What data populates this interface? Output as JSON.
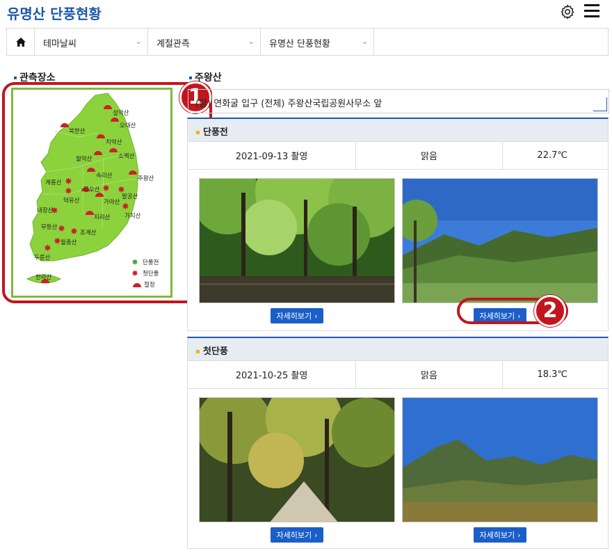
{
  "header": {
    "title": "유명산 단풍현황"
  },
  "nav": {
    "items": [
      "테마날씨",
      "계절관측",
      "유명산 단풍현황"
    ]
  },
  "left": {
    "section_title": "관측장소"
  },
  "map": {
    "mountains": [
      "설악산",
      "오대산",
      "북한산",
      "치악산",
      "월악산",
      "소백산",
      "속리산",
      "주왕산",
      "계룡산",
      "금오산",
      "팔공산",
      "덕유산",
      "가야산",
      "가지산",
      "내장산",
      "지리산",
      "무등산",
      "조계산",
      "월출산",
      "두륜산",
      "한라산"
    ],
    "legend": [
      "단풍전",
      "첫단풍",
      "절정"
    ],
    "colors": {
      "land": "#8cd23c",
      "frame": "#7dbb3b",
      "peak": "#c8232b",
      "leaf": "#c8232b",
      "before": "#4aa83a"
    }
  },
  "right": {
    "section_title": "주왕산",
    "location_select": "(탐) 연화굴 입구 (전체) 주왕산국립공원사무소 앞"
  },
  "panels": [
    {
      "title": "단풍전",
      "date": "2021-09-13 촬영",
      "weather": "맑음",
      "temp": "22.7℃",
      "button": "자세히보기",
      "button2": "자세히보기"
    },
    {
      "title": "첫단풍",
      "date": "2021-10-25 촬영",
      "weather": "맑음",
      "temp": "18.3℃",
      "button": "자세히보기",
      "button2": "자세히보기"
    }
  ],
  "annotations": [
    "1",
    "2"
  ]
}
